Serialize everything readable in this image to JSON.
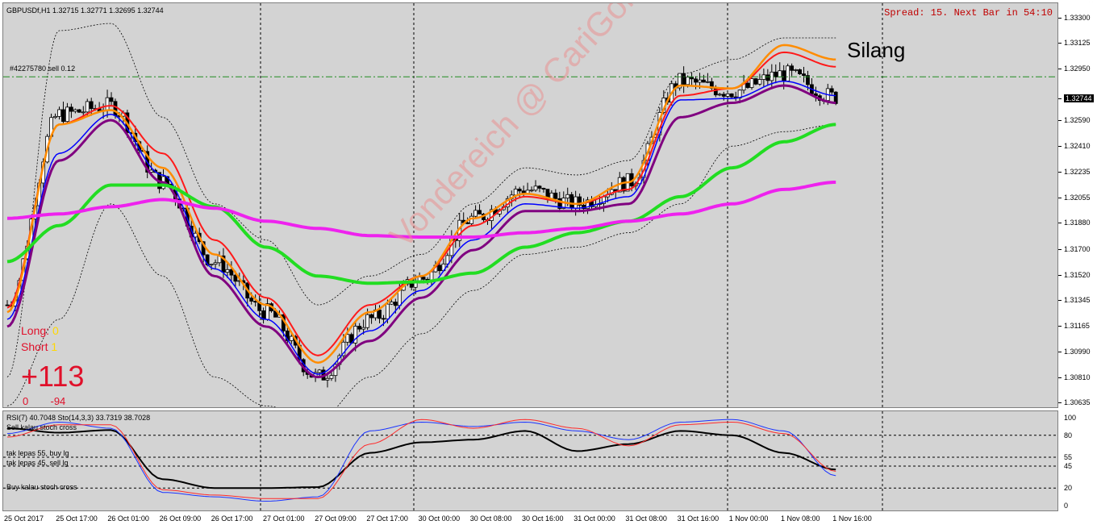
{
  "chart_header": {
    "symbol_info": "GBPUSDf,H1  1.32715 1.32771 1.32695 1.32744",
    "order_label": "#42275780 sell 0.12",
    "spread_info": "Spread: 15. Next Bar in 54:10",
    "note": "Silang",
    "watermark": "Vondereich @ CariGold Forum"
  },
  "trade_panel": {
    "long_label": "Long:",
    "long_value": "0",
    "short_label": "Short",
    "short_value": "1",
    "pnl": "+113",
    "left_value": "0",
    "right_value": "-94"
  },
  "price_axis": {
    "labels": [
      "1.33300",
      "1.33125",
      "1.32950",
      "1.32744",
      "1.32590",
      "1.32410",
      "1.32235",
      "1.32055",
      "1.31880",
      "1.31700",
      "1.31520",
      "1.31345",
      "1.31165",
      "1.30990",
      "1.30810",
      "1.30635"
    ],
    "current_price": "1.32744"
  },
  "oscillator_panel": {
    "info": "RSI(7) 40.7048  Sto(14,3,3) 33.7319 38.7028",
    "notes": [
      "Sell kalau stoch cross",
      "tak lepas 55, buy lg",
      "tak lepas 45, sell lg",
      "Buy kalau stoch cross"
    ],
    "levels": [
      "100",
      "80",
      "55",
      "45",
      "20",
      "0"
    ]
  },
  "time_axis": {
    "labels": [
      "25 Oct 2017",
      "25 Oct 17:00",
      "26 Oct 01:00",
      "26 Oct 09:00",
      "26 Oct 17:00",
      "27 Oct 01:00",
      "27 Oct 09:00",
      "27 Oct 17:00",
      "30 Oct 00:00",
      "30 Oct 08:00",
      "30 Oct 16:00",
      "31 Oct 00:00",
      "31 Oct 08:00",
      "31 Oct 16:00",
      "1 Nov 00:00",
      "1 Nov 08:00",
      "1 Nov 16:00"
    ]
  },
  "colors": {
    "chart_bg": "#d3d3d3",
    "bull_candle": "#ffffff",
    "bear_candle": "#000000",
    "ma_red": "#ff1a1a",
    "ma_orange": "#ff8c00",
    "ma_blue": "#0000ff",
    "ma_purple": "#800080",
    "ma_green": "#22dd22",
    "ma_magenta": "#ee22ee",
    "order_line": "#228b22",
    "rsi_line": "#000000",
    "stoch_main": "#1a33ff",
    "stoch_signal": "#ff2a2a"
  },
  "chart_data": {
    "type": "line",
    "symbol": "GBPUSDf",
    "timeframe": "H1",
    "ohlc_last": {
      "open": 1.32715,
      "high": 1.32771,
      "low": 1.32695,
      "close": 1.32744
    },
    "order_level": 1.3288,
    "ylim": [
      1.3058,
      1.3339
    ],
    "x": [
      "25 Oct 2017",
      "25 Oct 17:00",
      "26 Oct 01:00",
      "26 Oct 09:00",
      "26 Oct 17:00",
      "27 Oct 01:00",
      "27 Oct 09:00",
      "27 Oct 17:00",
      "30 Oct 00:00",
      "30 Oct 08:00",
      "30 Oct 16:00",
      "31 Oct 00:00",
      "31 Oct 08:00",
      "31 Oct 16:00",
      "1 Nov 00:00",
      "1 Nov 08:00",
      "1 Nov 16:00"
    ],
    "close": [
      1.313,
      1.3262,
      1.3268,
      1.3215,
      1.316,
      1.3125,
      1.308,
      1.312,
      1.3148,
      1.319,
      1.321,
      1.32,
      1.3215,
      1.3285,
      1.3278,
      1.329,
      1.3274
    ],
    "series": [
      {
        "values": [
          1.3128,
          1.3255,
          1.3268,
          1.3235,
          1.3175,
          1.3135,
          1.3095,
          1.313,
          1.315,
          1.3185,
          1.3205,
          1.32,
          1.321,
          1.3275,
          1.328,
          1.3305,
          1.3295
        ]
      },
      {
        "values": [
          1.3125,
          1.3255,
          1.3265,
          1.3225,
          1.3165,
          1.313,
          1.309,
          1.3125,
          1.315,
          1.319,
          1.3207,
          1.32,
          1.3215,
          1.3282,
          1.328,
          1.331,
          1.33
        ]
      },
      {
        "values": [
          1.312,
          1.3235,
          1.3262,
          1.322,
          1.3155,
          1.312,
          1.3082,
          1.3112,
          1.314,
          1.3175,
          1.32,
          1.3197,
          1.3205,
          1.3272,
          1.3273,
          1.3285,
          1.3275
        ]
      },
      {
        "values": [
          1.3115,
          1.323,
          1.3258,
          1.3215,
          1.315,
          1.3115,
          1.308,
          1.3105,
          1.3135,
          1.3168,
          1.3195,
          1.3195,
          1.32,
          1.326,
          1.327,
          1.3282,
          1.327
        ]
      },
      {
        "values": [
          1.316,
          1.3185,
          1.3213,
          1.3213,
          1.3198,
          1.317,
          1.315,
          1.3145,
          1.3146,
          1.3152,
          1.317,
          1.318,
          1.3188,
          1.3205,
          1.3225,
          1.3243,
          1.3255
        ]
      },
      {
        "values": [
          1.319,
          1.3193,
          1.3198,
          1.3203,
          1.3197,
          1.3188,
          1.3183,
          1.3178,
          1.3177,
          1.3177,
          1.318,
          1.3183,
          1.3188,
          1.3193,
          1.32,
          1.321,
          1.3215
        ]
      },
      {
        "values": [
          1.308,
          1.332,
          1.3325,
          1.326,
          1.32,
          1.3175,
          1.313,
          1.315,
          1.3165,
          1.32,
          1.3225,
          1.322,
          1.323,
          1.329,
          1.33,
          1.3315,
          1.3315
        ]
      },
      {
        "values": [
          1.306,
          1.312,
          1.32,
          1.315,
          1.308,
          1.306,
          1.305,
          1.308,
          1.311,
          1.314,
          1.3165,
          1.317,
          1.318,
          1.32,
          1.324,
          1.325,
          1.3255
        ]
      }
    ],
    "oscillator": {
      "ylim": [
        0,
        100
      ],
      "levels": [
        80,
        55,
        45,
        20
      ],
      "series": [
        {
          "values": [
            88,
            83,
            86,
            30,
            20,
            20,
            21,
            60,
            72,
            75,
            85,
            62,
            70,
            85,
            80,
            60,
            41
          ]
        },
        {
          "values": [
            82,
            95,
            88,
            15,
            10,
            5,
            10,
            85,
            95,
            90,
            95,
            85,
            75,
            95,
            98,
            85,
            34
          ]
        },
        {
          "values": [
            78,
            92,
            92,
            18,
            12,
            8,
            8,
            70,
            98,
            88,
            98,
            88,
            68,
            92,
            95,
            82,
            39
          ]
        }
      ]
    }
  }
}
